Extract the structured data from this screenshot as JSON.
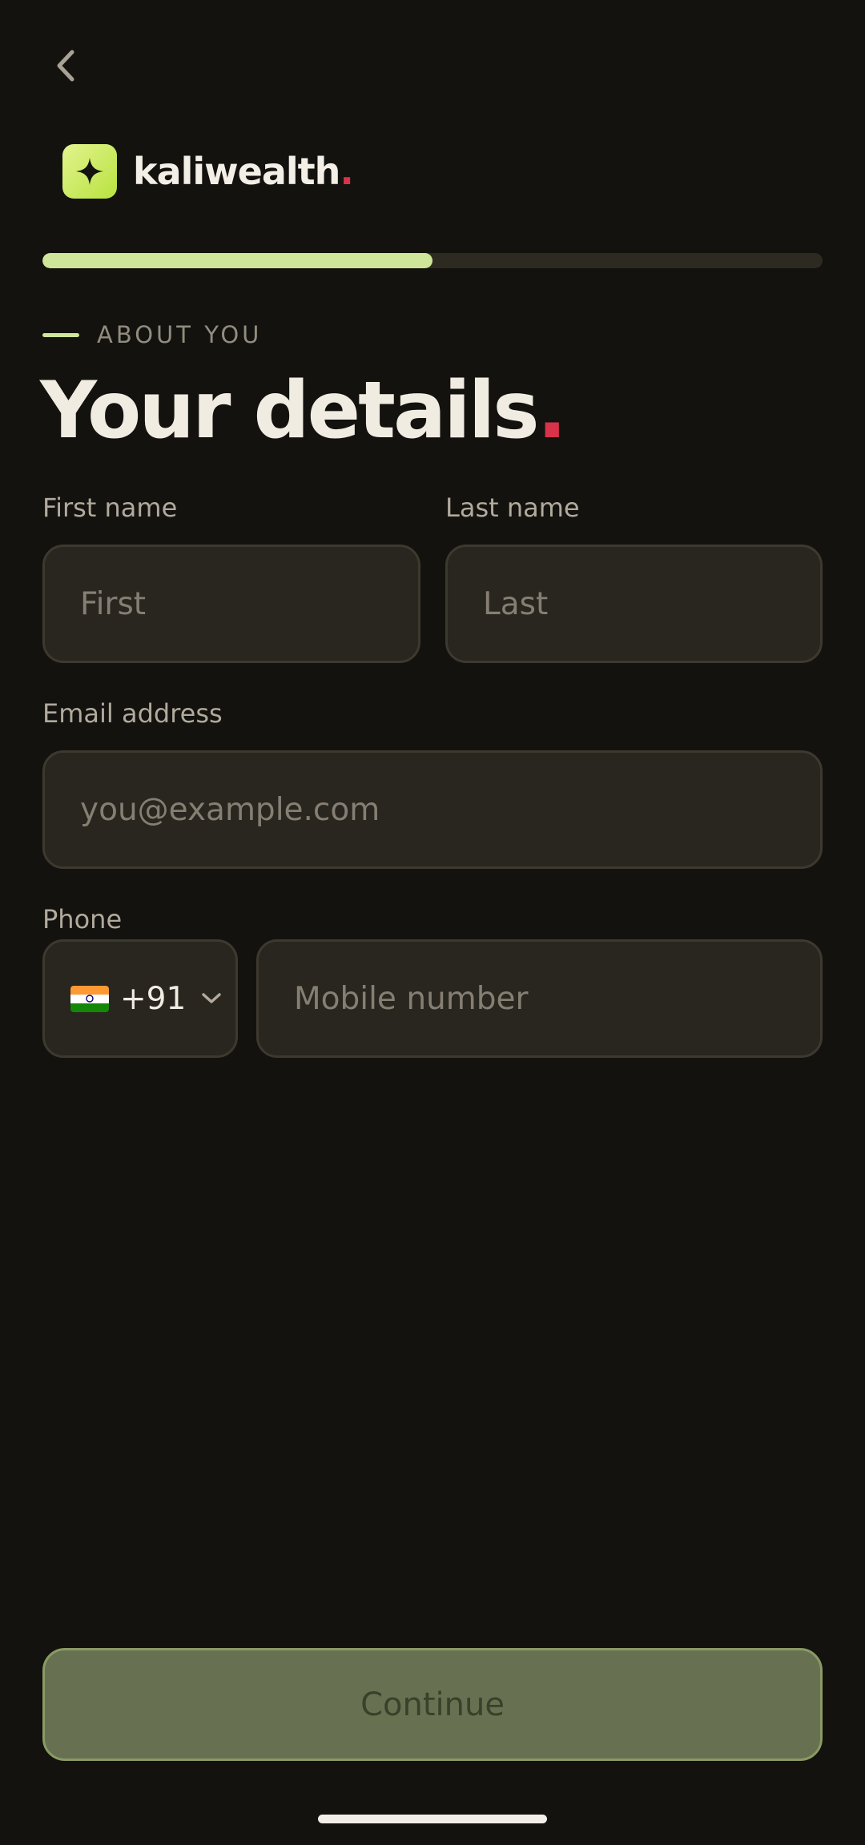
{
  "header": {
    "back_icon": "chevron-left-icon",
    "brand_name": "kaliwealth",
    "brand_dot": ".",
    "brand_logo_icon": "sparkle-star-icon",
    "brand_color": "#c6ec5a",
    "accent_dot_color": "#d8334a"
  },
  "progress": {
    "fraction": 0.5
  },
  "section": {
    "eyebrow": "ABOUT YOU",
    "title": "Your details",
    "title_dot": "."
  },
  "form": {
    "first_name": {
      "label": "First name",
      "placeholder": "First",
      "value": ""
    },
    "last_name": {
      "label": "Last name",
      "placeholder": "Last",
      "value": ""
    },
    "email": {
      "label": "Email address",
      "placeholder": "you@example.com",
      "value": ""
    },
    "phone": {
      "label": "Phone",
      "country_flag": "india-flag-icon",
      "dial_code": "+91",
      "placeholder": "Mobile number",
      "value": ""
    }
  },
  "footer": {
    "continue_label": "Continue"
  }
}
